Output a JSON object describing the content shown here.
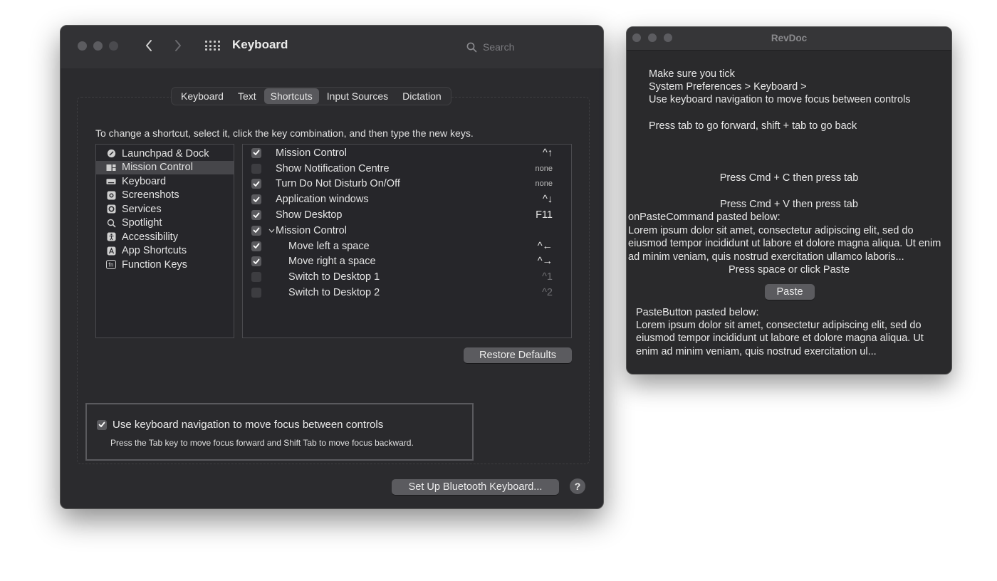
{
  "keyboard_window": {
    "title": "Keyboard",
    "search_placeholder": "Search",
    "tabs": [
      {
        "label": "Keyboard",
        "active": false
      },
      {
        "label": "Text",
        "active": false
      },
      {
        "label": "Shortcuts",
        "active": true
      },
      {
        "label": "Input Sources",
        "active": false
      },
      {
        "label": "Dictation",
        "active": false
      }
    ],
    "instructions": "To change a shortcut, select it, click the key combination, and then type the new keys.",
    "categories": [
      {
        "label": "Launchpad & Dock",
        "icon": "launchpad-icon"
      },
      {
        "label": "Mission Control",
        "icon": "mission-control-icon",
        "selected": true
      },
      {
        "label": "Keyboard",
        "icon": "keyboard-icon"
      },
      {
        "label": "Screenshots",
        "icon": "screenshot-icon"
      },
      {
        "label": "Services",
        "icon": "gear-icon"
      },
      {
        "label": "Spotlight",
        "icon": "magnifier-icon"
      },
      {
        "label": "Accessibility",
        "icon": "accessibility-icon"
      },
      {
        "label": "App Shortcuts",
        "icon": "app-shortcuts-icon"
      },
      {
        "label": "Function Keys",
        "icon": "fn-icon"
      }
    ],
    "shortcuts": [
      {
        "label": "Mission Control",
        "key": "^↑",
        "checked": true
      },
      {
        "label": "Show Notification Centre",
        "key": "none",
        "checked": false
      },
      {
        "label": "Turn Do Not Disturb On/Off",
        "key": "none",
        "checked": true
      },
      {
        "label": "Application windows",
        "key": "^↓",
        "checked": true
      },
      {
        "label": "Show Desktop",
        "key": "F11",
        "checked": true
      },
      {
        "label": "Mission Control",
        "key": "",
        "checked": true
      },
      {
        "label": "Move left a space",
        "key": "^←",
        "checked": true
      },
      {
        "label": "Move right a space",
        "key": "^→",
        "checked": true
      },
      {
        "label": "Switch to Desktop 1",
        "key": "^1",
        "checked": false
      },
      {
        "label": "Switch to Desktop 2",
        "key": "^2",
        "checked": false
      }
    ],
    "restore_label": "Restore Defaults",
    "nav_checkbox_label": "Use keyboard navigation to move focus between controls",
    "nav_description": "Press the Tab key to move focus forward and Shift Tab to move focus backward.",
    "bluetooth_label": "Set Up Bluetooth Keyboard...",
    "help_label": "?"
  },
  "revdoc_window": {
    "title": "RevDoc",
    "intro_lines": [
      "Make sure you tick",
      "System Preferences > Keyboard >",
      "Use keyboard navigation to move focus between controls"
    ],
    "tab_hint": "Press tab to go forward, shift + tab to go back",
    "copy_hint": "Press Cmd + C then press tab",
    "paste_hint": "Press Cmd + V then press tab",
    "paste_command_heading": "onPasteCommand pasted below:",
    "paste_command_text": "Lorem ipsum dolor sit amet, consectetur adipiscing elit, sed do eiusmod tempor incididunt ut labore et dolore magna aliqua. Ut enim ad minim veniam, quis nostrud exercitation ullamco laboris...",
    "space_hint": "Press space or click Paste",
    "paste_button_label": "Paste",
    "paste_button_heading": "PasteButton pasted below:",
    "paste_button_text": "Lorem ipsum dolor sit amet, consectetur adipiscing elit, sed do eiusmod tempor incididunt ut labore et dolore magna aliqua. Ut enim ad minim veniam, quis nostrud exercitation ul..."
  }
}
